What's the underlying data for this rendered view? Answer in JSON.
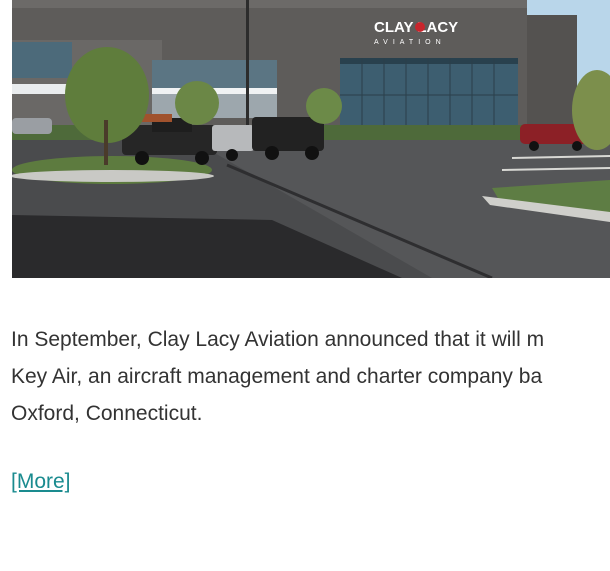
{
  "article": {
    "image": {
      "sign_main": "CLAY LACY",
      "sign_sub": "AVIATION"
    },
    "body_lines": [
      "In September, Clay Lacy Aviation announced that it will m",
      "Key Air, an aircraft management and charter company ba",
      "Oxford, Connecticut."
    ],
    "more_link": "[More]"
  },
  "colors": {
    "link": "#1a8b8f",
    "text": "#333333"
  }
}
